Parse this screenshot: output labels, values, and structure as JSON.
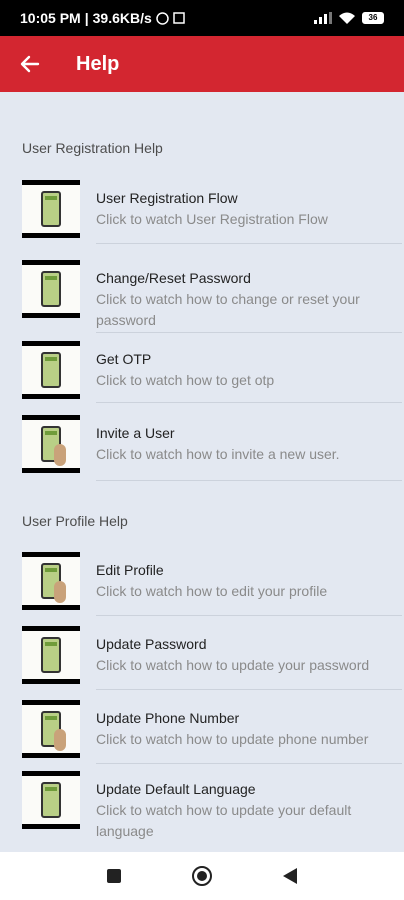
{
  "status": {
    "time": "10:05 PM",
    "speed": "39.6KB/s",
    "battery": "36"
  },
  "app_bar": {
    "title": "Help"
  },
  "sections": [
    {
      "header": "User Registration Help",
      "items": [
        {
          "title": "User Registration Flow",
          "subtitle": "Click to watch User Registration Flow"
        },
        {
          "title": "Change/Reset Password",
          "subtitle": "Click to watch how to change or reset your password"
        },
        {
          "title": "Get OTP",
          "subtitle": "Click to watch how to get otp"
        },
        {
          "title": "Invite a User",
          "subtitle": "Click to watch how to invite a new user."
        }
      ]
    },
    {
      "header": "User Profile Help",
      "items": [
        {
          "title": "Edit Profile",
          "subtitle": "Click to watch how to edit your profile"
        },
        {
          "title": "Update Password",
          "subtitle": "Click to watch how to update your password"
        },
        {
          "title": "Update Phone Number",
          "subtitle": "Click to watch how to update phone number"
        },
        {
          "title": "Update Default Language",
          "subtitle": "Click to watch how to update your default language"
        }
      ]
    }
  ],
  "icons": [
    "back-arrow-icon",
    "square-nav-icon",
    "home-nav-icon",
    "back-nav-icon",
    "signal-icon",
    "wifi-icon",
    "battery-icon"
  ]
}
